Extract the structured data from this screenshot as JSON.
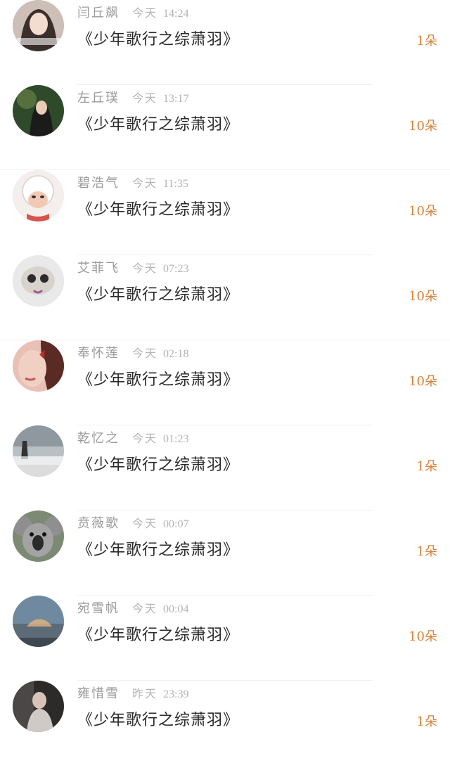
{
  "messages": [
    {
      "name": "闫丘飙",
      "day": "今天",
      "time": "14:24",
      "title": "《少年歌行之综萧羽》",
      "count": "1朵",
      "avatar_color": "#b9a7a1"
    },
    {
      "name": "左丘璞",
      "day": "今天",
      "time": "13:17",
      "title": "《少年歌行之综萧羽》",
      "count": "10朵",
      "avatar_color": "#3c5a34"
    },
    {
      "name": "碧浩气",
      "day": "今天",
      "time": "11:35",
      "title": "《少年歌行之综萧羽》",
      "count": "10朵",
      "avatar_color": "#f1ecea"
    },
    {
      "name": "艾菲飞",
      "day": "今天",
      "time": "07:23",
      "title": "《少年歌行之综萧羽》",
      "count": "10朵",
      "avatar_color": "#e4e4e4"
    },
    {
      "name": "奉怀莲",
      "day": "今天",
      "time": "02:18",
      "title": "《少年歌行之综萧羽》",
      "count": "10朵",
      "avatar_color": "#c58478"
    },
    {
      "name": "乾忆之",
      "day": "今天",
      "time": "01:23",
      "title": "《少年歌行之综萧羽》",
      "count": "1朵",
      "avatar_color": "#a7b2b7"
    },
    {
      "name": "贲薇歌",
      "day": "今天",
      "time": "00:07",
      "title": "《少年歌行之综萧羽》",
      "count": "1朵",
      "avatar_color": "#7f8c7a"
    },
    {
      "name": "宛雪帆",
      "day": "今天",
      "time": "00:04",
      "title": "《少年歌行之综萧羽》",
      "count": "10朵",
      "avatar_color": "#7e96a9"
    },
    {
      "name": "雍惜雪",
      "day": "昨天",
      "time": "23:39",
      "title": "《少年歌行之综萧羽》",
      "count": "1朵",
      "avatar_color": "#3d3b3a"
    }
  ]
}
